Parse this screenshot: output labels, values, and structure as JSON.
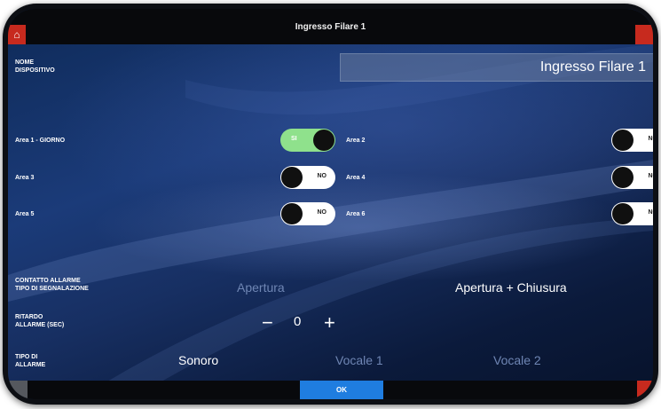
{
  "header": {
    "title": "Ingresso Filare 1"
  },
  "device_name": {
    "label": "NOME\nDISPOSITIVO",
    "value": "Ingresso Filare 1"
  },
  "areas": [
    {
      "label": "Area 1 - GIORNO",
      "state": "SI",
      "on": true
    },
    {
      "label": "Area 2",
      "state": "NO",
      "on": false
    },
    {
      "label": "Area 3",
      "state": "NO",
      "on": false
    },
    {
      "label": "Area 4",
      "state": "NO",
      "on": false
    },
    {
      "label": "Area 5",
      "state": "NO",
      "on": false
    },
    {
      "label": "Area 6",
      "state": "NO",
      "on": false
    }
  ],
  "contact": {
    "label": "CONTATTO ALLARME\nTIPO DI SEGNALAZIONE",
    "options": [
      "Apertura",
      "Apertura + Chiusura"
    ],
    "selected": "Apertura + Chiusura"
  },
  "delay": {
    "label": "RITARDO\nALLARME (SEC)",
    "minus": "−",
    "value": "0",
    "plus": "+"
  },
  "alarm_type": {
    "label": "TIPO DI\nALLARME",
    "options": [
      "Sonoro",
      "Vocale 1",
      "Vocale 2"
    ],
    "selected": "Sonoro"
  },
  "footer": {
    "ok_label": "OK"
  },
  "colors": {
    "accent_red": "#c72a1e",
    "ok_blue": "#1f7de0",
    "toggle_on_green": "#8fe18c",
    "background_blue": "#1b3b79"
  }
}
